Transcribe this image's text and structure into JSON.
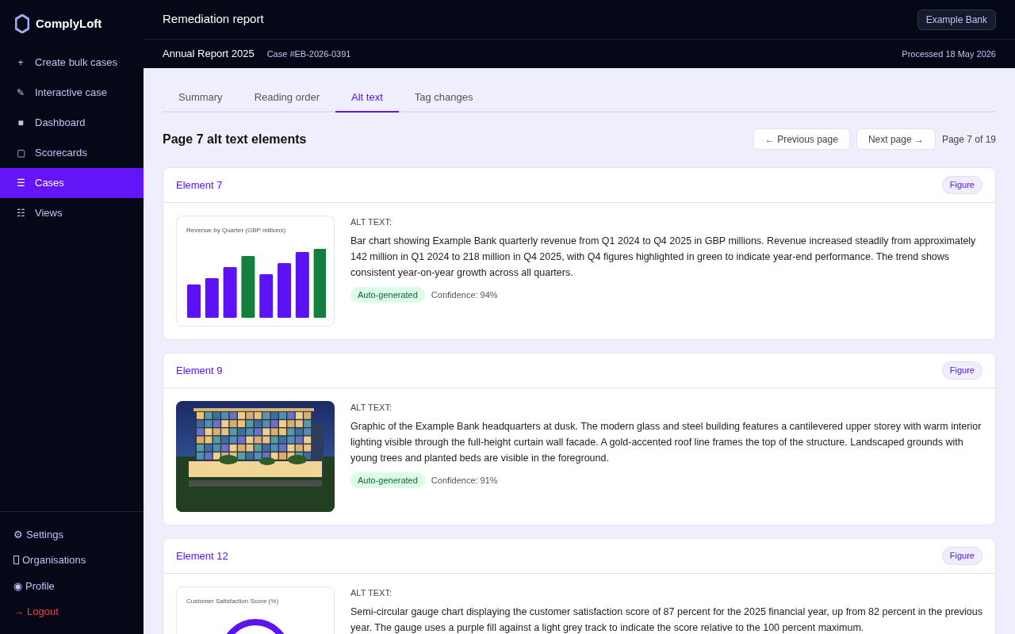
{
  "brand": {
    "name": "ComplyLoft"
  },
  "sidebar": {
    "items": [
      {
        "icon": "+",
        "label": "Create bulk cases",
        "selected": false
      },
      {
        "icon": "✎",
        "label": "Interactive case",
        "selected": false
      },
      {
        "icon": "■",
        "label": "Dashboard",
        "selected": false
      },
      {
        "icon": "▢",
        "label": "Scorecards",
        "selected": false
      },
      {
        "icon": "☰",
        "label": "Cases",
        "selected": true
      },
      {
        "icon": "☷",
        "label": "Views",
        "selected": false
      }
    ],
    "footer_items": [
      {
        "icon": "⚙",
        "label": "Settings",
        "kind": "normal"
      },
      {
        "label": "Organisations",
        "kind": "normal"
      },
      {
        "icon": "◉",
        "label": "Profile",
        "kind": "normal"
      },
      {
        "icon": "→",
        "label": "Logout",
        "kind": "danger"
      }
    ]
  },
  "header": {
    "title": "Remediation report",
    "org": "Example Bank",
    "document": "Annual Report 2025",
    "case": "Case #EB-2026-0391",
    "processed": "Processed 18 May 2026"
  },
  "tabs": [
    {
      "label": "Summary",
      "selected": false
    },
    {
      "label": "Reading order",
      "selected": false
    },
    {
      "label": "Alt text",
      "selected": true
    },
    {
      "label": "Tag changes",
      "selected": false
    }
  ],
  "page_heading": "Page 7 alt text elements",
  "pagination": {
    "previous": "← Previous page",
    "next": "Next page →",
    "status": "Page 7 of 19"
  },
  "elements": [
    {
      "title": "Element 7",
      "tag": "Figure",
      "kind": "bar-chart",
      "preview_title": "Revenue by Quarter (GBP millions)",
      "alt_label": "ALT TEXT:",
      "alt_text": "Bar chart showing Example Bank quarterly revenue from Q1 2024 to Q4 2025 in GBP millions. Revenue increased steadily from approximately 142 million in Q1 2024 to 218 million in Q4 2025, with Q4 figures highlighted in green to indicate year-end performance. The trend shows consistent year-on-year growth across all quarters.",
      "badge": "Auto-generated",
      "confidence": "Confidence: 94%"
    },
    {
      "title": "Element 9",
      "tag": "Figure",
      "alt_label": "ALT TEXT:",
      "alt_text": "Graphic of the Example Bank headquarters at dusk. The modern glass and steel building features a cantilevered upper storey with warm interior lighting visible through the full-height curtain wall facade. A gold-accented roof line frames the top of the structure. Landscaped grounds with young trees and planted beds are visible in the foreground.",
      "badge": "Auto-generated",
      "confidence": "Confidence: 91%"
    },
    {
      "title": "Element 12",
      "tag": "Figure",
      "kind": "gauge",
      "preview_title": "Customer Satisfaction Score (%)",
      "alt_label": "ALT TEXT:",
      "alt_text": "Semi-circular gauge chart displaying the customer satisfaction score of 87 percent for the 2025 financial year, up from 82 percent in the previous year. The gauge uses a purple fill against a light grey track to indicate the score relative to the 100 percent maximum."
    }
  ]
}
